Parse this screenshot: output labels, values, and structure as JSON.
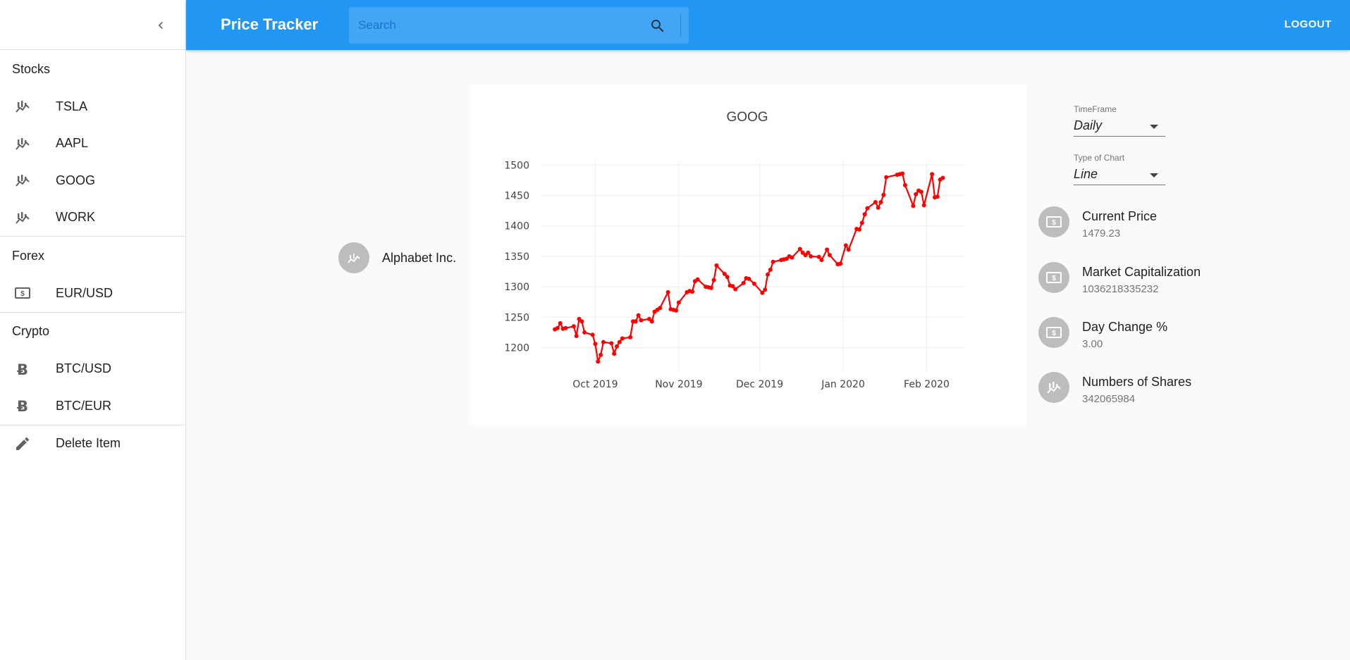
{
  "app": {
    "title": "Price Tracker"
  },
  "search": {
    "placeholder": "Search"
  },
  "topbar": {
    "logout_label": "LOGOUT"
  },
  "sidebar": {
    "sections": [
      {
        "header": "Stocks",
        "items": [
          {
            "label": "TSLA",
            "icon": "chart-icon"
          },
          {
            "label": "AAPL",
            "icon": "chart-icon"
          },
          {
            "label": "GOOG",
            "icon": "chart-icon"
          },
          {
            "label": "WORK",
            "icon": "chart-icon"
          }
        ]
      },
      {
        "header": "Forex",
        "items": [
          {
            "label": "EUR/USD",
            "icon": "money-icon"
          }
        ]
      },
      {
        "header": "Crypto",
        "items": [
          {
            "label": "BTC/USD",
            "icon": "bitcoin-icon"
          },
          {
            "label": "BTC/EUR",
            "icon": "bitcoin-icon"
          }
        ]
      }
    ],
    "delete_label": "Delete Item"
  },
  "company": {
    "name": "Alphabet Inc."
  },
  "controls": {
    "timeframe": {
      "label": "TimeFrame",
      "value": "Daily"
    },
    "chart_type": {
      "label": "Type of Chart",
      "value": "Line"
    }
  },
  "stats": [
    {
      "title": "Current Price",
      "value": "1479.23",
      "icon": "money-icon"
    },
    {
      "title": "Market Capitalization",
      "value": "1036218335232",
      "icon": "money-icon"
    },
    {
      "title": "Day Change %",
      "value": "3.00",
      "icon": "money-icon"
    },
    {
      "title": "Numbers of Shares",
      "value": "342065984",
      "icon": "chart-icon"
    }
  ],
  "colors": {
    "accent": "#2196f3",
    "search_bg": "#42a5f5",
    "line": "#ff0000"
  },
  "chart_data": {
    "type": "line",
    "title": "GOOG",
    "xlabel": "",
    "ylabel": "",
    "ylim": [
      1160,
      1505
    ],
    "y_ticks": [
      1200,
      1250,
      1300,
      1350,
      1400,
      1450,
      1500
    ],
    "x_ticks": [
      {
        "label": "Oct 2019",
        "date": "2019-10-01"
      },
      {
        "label": "Nov 2019",
        "date": "2019-11-01"
      },
      {
        "label": "Dec 2019",
        "date": "2019-12-01"
      },
      {
        "label": "Jan 2020",
        "date": "2020-01-01"
      },
      {
        "label": "Feb 2020",
        "date": "2020-02-01"
      }
    ],
    "xlim": [
      "2019-09-11",
      "2020-02-15"
    ],
    "grid": true,
    "series": [
      {
        "values": [
          [
            "2019-09-16",
            1230
          ],
          [
            "2019-09-17",
            1232
          ],
          [
            "2019-09-18",
            1240
          ],
          [
            "2019-09-19",
            1231
          ],
          [
            "2019-09-20",
            1232
          ],
          [
            "2019-09-23",
            1235
          ],
          [
            "2019-09-24",
            1219
          ],
          [
            "2019-09-25",
            1247
          ],
          [
            "2019-09-26",
            1243
          ],
          [
            "2019-09-27",
            1225
          ],
          [
            "2019-09-30",
            1221
          ],
          [
            "2019-10-01",
            1206
          ],
          [
            "2019-10-02",
            1177
          ],
          [
            "2019-10-03",
            1188
          ],
          [
            "2019-10-04",
            1209
          ],
          [
            "2019-10-07",
            1207
          ],
          [
            "2019-10-08",
            1190
          ],
          [
            "2019-10-09",
            1202
          ],
          [
            "2019-10-10",
            1209
          ],
          [
            "2019-10-11",
            1215
          ],
          [
            "2019-10-14",
            1217
          ],
          [
            "2019-10-15",
            1243
          ],
          [
            "2019-10-16",
            1243
          ],
          [
            "2019-10-17",
            1253
          ],
          [
            "2019-10-18",
            1245
          ],
          [
            "2019-10-21",
            1247
          ],
          [
            "2019-10-22",
            1243
          ],
          [
            "2019-10-23",
            1259
          ],
          [
            "2019-10-24",
            1262
          ],
          [
            "2019-10-25",
            1265
          ],
          [
            "2019-10-28",
            1291
          ],
          [
            "2019-10-29",
            1263
          ],
          [
            "2019-10-30",
            1262
          ],
          [
            "2019-10-31",
            1261
          ],
          [
            "2019-11-01",
            1274
          ],
          [
            "2019-11-04",
            1291
          ],
          [
            "2019-11-05",
            1293
          ],
          [
            "2019-11-06",
            1292
          ],
          [
            "2019-11-07",
            1309
          ],
          [
            "2019-11-08",
            1312
          ],
          [
            "2019-11-11",
            1300
          ],
          [
            "2019-11-12",
            1299
          ],
          [
            "2019-11-13",
            1298
          ],
          [
            "2019-11-14",
            1311
          ],
          [
            "2019-11-15",
            1335
          ],
          [
            "2019-11-18",
            1321
          ],
          [
            "2019-11-19",
            1316
          ],
          [
            "2019-11-20",
            1302
          ],
          [
            "2019-11-21",
            1301
          ],
          [
            "2019-11-22",
            1296
          ],
          [
            "2019-11-25",
            1306
          ],
          [
            "2019-11-26",
            1314
          ],
          [
            "2019-11-27",
            1313
          ],
          [
            "2019-11-29",
            1305
          ],
          [
            "2019-12-02",
            1290
          ],
          [
            "2019-12-03",
            1295
          ],
          [
            "2019-12-04",
            1320
          ],
          [
            "2019-12-05",
            1328
          ],
          [
            "2019-12-06",
            1341
          ],
          [
            "2019-12-09",
            1344
          ],
          [
            "2019-12-10",
            1345
          ],
          [
            "2019-12-11",
            1346
          ],
          [
            "2019-12-12",
            1350
          ],
          [
            "2019-12-13",
            1348
          ],
          [
            "2019-12-16",
            1362
          ],
          [
            "2019-12-17",
            1356
          ],
          [
            "2019-12-18",
            1352
          ],
          [
            "2019-12-19",
            1356
          ],
          [
            "2019-12-20",
            1350
          ],
          [
            "2019-12-23",
            1349
          ],
          [
            "2019-12-24",
            1344
          ],
          [
            "2019-12-26",
            1361
          ],
          [
            "2019-12-27",
            1352
          ],
          [
            "2019-12-30",
            1337
          ],
          [
            "2019-12-31",
            1338
          ],
          [
            "2020-01-02",
            1368
          ],
          [
            "2020-01-03",
            1361
          ],
          [
            "2020-01-06",
            1395
          ],
          [
            "2020-01-07",
            1394
          ],
          [
            "2020-01-08",
            1405
          ],
          [
            "2020-01-09",
            1419
          ],
          [
            "2020-01-10",
            1429
          ],
          [
            "2020-01-13",
            1439
          ],
          [
            "2020-01-14",
            1430
          ],
          [
            "2020-01-15",
            1439
          ],
          [
            "2020-01-16",
            1451
          ],
          [
            "2020-01-17",
            1480
          ],
          [
            "2020-01-21",
            1484
          ],
          [
            "2020-01-22",
            1485
          ],
          [
            "2020-01-23",
            1486
          ],
          [
            "2020-01-24",
            1467
          ],
          [
            "2020-01-27",
            1433
          ],
          [
            "2020-01-28",
            1452
          ],
          [
            "2020-01-29",
            1458
          ],
          [
            "2020-01-30",
            1456
          ],
          [
            "2020-01-31",
            1434
          ],
          [
            "2020-02-03",
            1485
          ],
          [
            "2020-02-04",
            1447
          ],
          [
            "2020-02-05",
            1448
          ],
          [
            "2020-02-06",
            1476
          ],
          [
            "2020-02-07",
            1479
          ]
        ]
      }
    ]
  }
}
